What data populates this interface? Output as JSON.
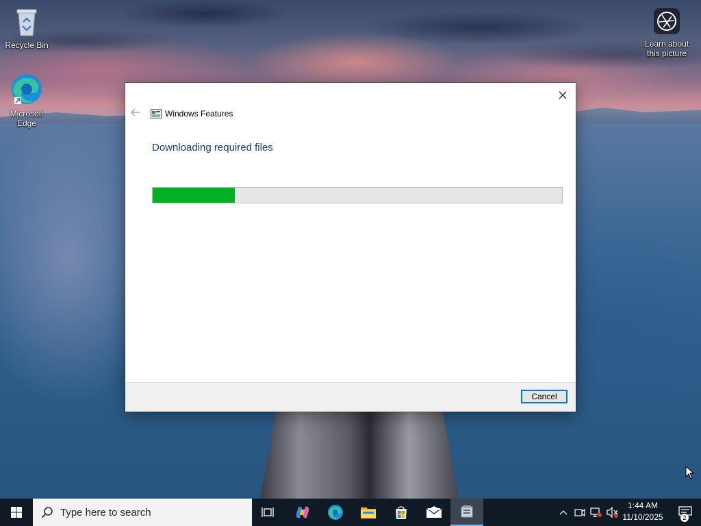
{
  "desktop": {
    "icons": [
      {
        "label": "Recycle Bin",
        "icon": "recycle-bin-icon"
      },
      {
        "label": "Microsoft Edge",
        "icon": "edge-icon"
      },
      {
        "label": "Learn about this picture",
        "icon": "camera-icon"
      }
    ]
  },
  "dialog": {
    "app_title": "Windows Features",
    "heading": "Downloading required files",
    "progress_fraction": 0.2,
    "cancel_label": "Cancel"
  },
  "taskbar": {
    "search_placeholder": "Type here to search",
    "pinned": [
      "task-view-icon",
      "copilot-icon",
      "edge-icon",
      "file-explorer-icon",
      "store-icon",
      "mail-icon",
      "windows-features-icon"
    ],
    "time": "1:44 AM",
    "date": "11/10/2025",
    "notification_count": "2"
  },
  "colors": {
    "progress_green": "#06b025",
    "heading_blue": "#1a3d7c",
    "accent": "#0078d7",
    "taskbar": "#0f1a24"
  }
}
